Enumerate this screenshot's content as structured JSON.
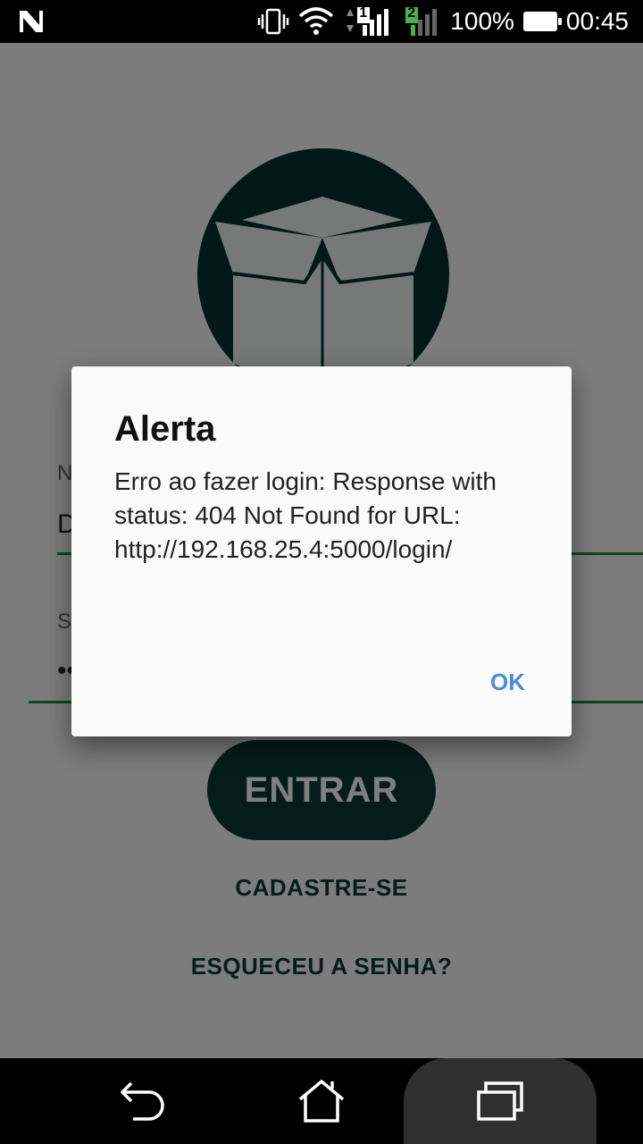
{
  "status_bar": {
    "battery_percent": "100%",
    "time": "00:45",
    "sim1_label": "1",
    "sim2_label": "2",
    "notification_icon": "n-icon",
    "icons": [
      "vibrate-icon",
      "wifi-icon",
      "signal-icon",
      "battery-icon"
    ]
  },
  "login": {
    "logo_icon": "open-box-icon",
    "username_label": "N",
    "username_value": "D",
    "password_label": "S",
    "password_value": "••",
    "submit_label": "ENTRAR",
    "register_label": "CADASTRE-SE",
    "forgot_label": "ESQUECEU A SENHA?"
  },
  "dialog": {
    "title": "Alerta",
    "message": "Erro ao fazer login: Response with status: 404 Not Found for URL: http://192.168.25.4:5000/login/",
    "ok_label": "OK"
  },
  "nav_bar": {
    "icons": [
      "back-icon",
      "home-icon",
      "recents-icon"
    ]
  },
  "colors": {
    "brand_dark": "#00332c",
    "accent_green": "#1f8a3d",
    "dialog_button": "#4a8de0"
  }
}
